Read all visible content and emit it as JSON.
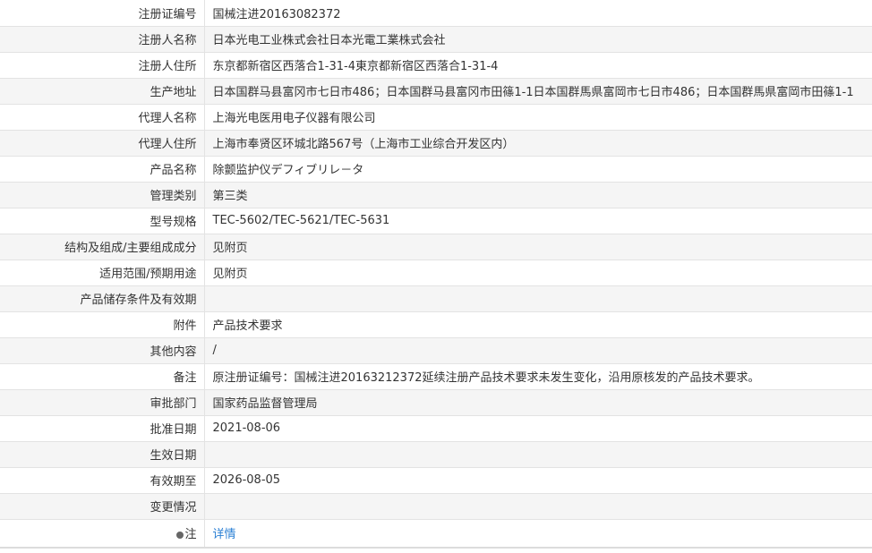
{
  "rows": [
    {
      "label": "注册证编号",
      "value": "国械注进20163082372"
    },
    {
      "label": "注册人名称",
      "value": "日本光电工业株式会社日本光電工業株式会社"
    },
    {
      "label": "注册人住所",
      "value": "东京都新宿区西落合1-31-4東京都新宿区西落合1-31-4"
    },
    {
      "label": "生产地址",
      "value": "日本国群马县富冈市七日市486；日本国群马县富冈市田篠1-1日本国群馬県富岡市七日市486；日本国群馬県富岡市田篠1-1"
    },
    {
      "label": "代理人名称",
      "value": "上海光电医用电子仪器有限公司"
    },
    {
      "label": "代理人住所",
      "value": "上海市奉贤区环城北路567号（上海市工业综合开发区内）"
    },
    {
      "label": "产品名称",
      "value": "除颤监护仪デフィブリレ－タ"
    },
    {
      "label": "管理类别",
      "value": "第三类"
    },
    {
      "label": "型号规格",
      "value": "TEC-5602/TEC-5621/TEC-5631"
    },
    {
      "label": "结构及组成/主要组成成分",
      "value": "见附页"
    },
    {
      "label": "适用范围/预期用途",
      "value": "见附页"
    },
    {
      "label": "产品储存条件及有效期",
      "value": ""
    },
    {
      "label": "附件",
      "value": "产品技术要求"
    },
    {
      "label": "其他内容",
      "value": "/"
    },
    {
      "label": "备注",
      "value": "原注册证编号：国械注进20163212372延续注册产品技术要求未发生变化，沿用原核发的产品技术要求。"
    },
    {
      "label": "审批部门",
      "value": "国家药品监督管理局"
    },
    {
      "label": "批准日期",
      "value": "2021-08-06"
    },
    {
      "label": "生效日期",
      "value": ""
    },
    {
      "label": "有效期至",
      "value": "2026-08-05"
    },
    {
      "label": "变更情况",
      "value": ""
    }
  ],
  "note": {
    "icon": "pin-icon",
    "label": "注",
    "link_text": "详情",
    "link_color": "#2a7fd4"
  }
}
